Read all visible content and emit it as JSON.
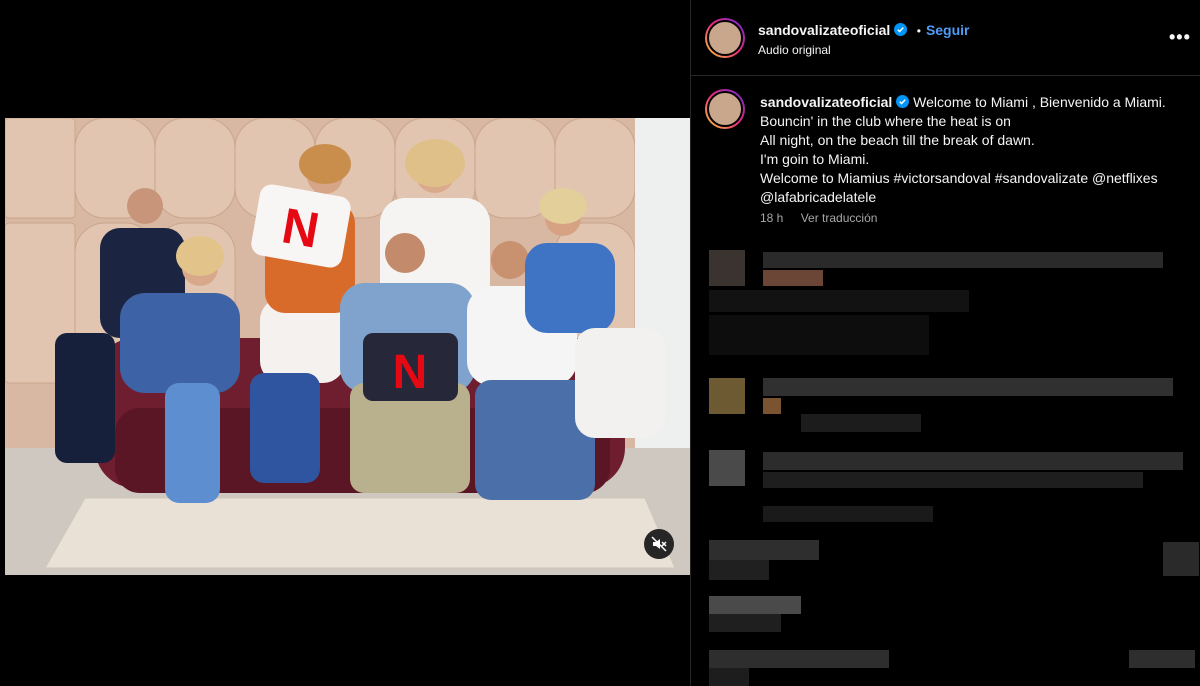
{
  "post": {
    "username": "sandovalizateoficial",
    "follow_label": "Seguir",
    "audio_label": "Audio original",
    "more_label": "•••",
    "separator": "•"
  },
  "caption": {
    "username": "sandovalizateoficial",
    "lines": [
      "Welcome to Miami , Bienvenido a Miami.",
      "Bouncin' in the club where the heat is on",
      "All night, on the beach till the break of dawn.",
      "I'm goin to Miami.",
      "Welcome to Miamius #victorsandoval #sandovalizate @netflixes",
      "@lafabricadelatele"
    ],
    "time": "18 h",
    "translate_label": "Ver traducción"
  },
  "media": {
    "pillow_letter": "N"
  },
  "colors": {
    "accent": "#4f9cf7",
    "netflix_red": "#e50914",
    "background": "#000000"
  },
  "icons": {
    "mute": "speaker-muted-icon",
    "verified": "verified-badge-icon",
    "more": "more-options-icon"
  }
}
